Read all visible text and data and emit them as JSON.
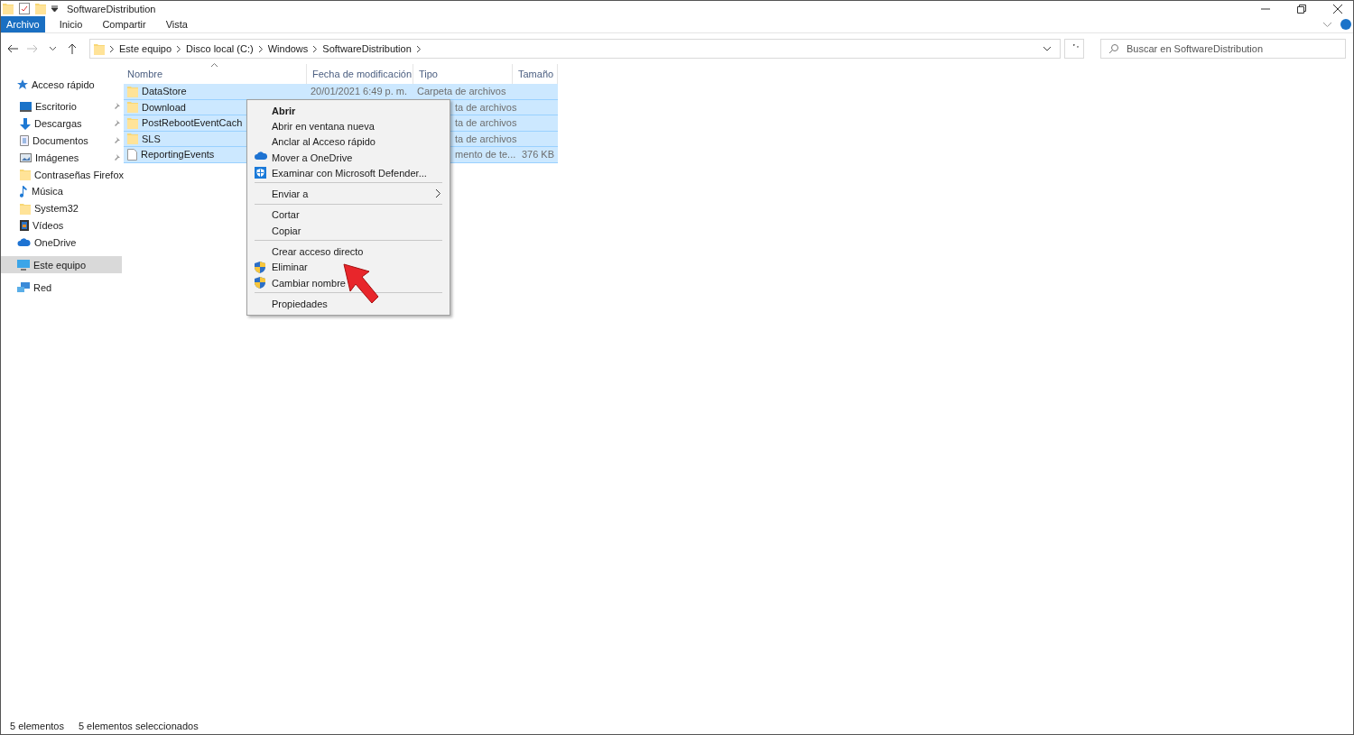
{
  "window": {
    "title": "SoftwareDistribution"
  },
  "ribbon_tabs": [
    {
      "label": "Archivo",
      "selected": true
    },
    {
      "label": "Inicio",
      "selected": false
    },
    {
      "label": "Compartir",
      "selected": false
    },
    {
      "label": "Vista",
      "selected": false
    }
  ],
  "address": {
    "crumbs": [
      "Este equipo",
      "Disco local (C:)",
      "Windows",
      "SoftwareDistribution"
    ]
  },
  "search": {
    "placeholder": "Buscar en SoftwareDistribution"
  },
  "sidebar": {
    "items": [
      {
        "label": "Acceso rápido",
        "selected": false,
        "children": [
          {
            "label": "Escritorio",
            "selected": false,
            "pinned": true
          },
          {
            "label": "Descargas",
            "selected": false,
            "pinned": true
          },
          {
            "label": "Documentos",
            "selected": false,
            "pinned": true
          },
          {
            "label": "Imágenes",
            "selected": false,
            "pinned": true
          },
          {
            "label": "Contraseñas Firefox",
            "selected": false,
            "pinned": false
          },
          {
            "label": "Música",
            "selected": false,
            "pinned": false
          },
          {
            "label": "System32",
            "selected": false,
            "pinned": false
          },
          {
            "label": "Vídeos",
            "selected": false,
            "pinned": false
          }
        ]
      },
      {
        "label": "OneDrive",
        "selected": false
      },
      {
        "label": "Este equipo",
        "selected": true
      },
      {
        "label": "Red",
        "selected": false
      }
    ]
  },
  "table": {
    "columns": [
      "Nombre",
      "Fecha de modificación",
      "Tipo",
      "Tamaño"
    ],
    "rows": [
      {
        "kind": "folder",
        "name": "DataStore",
        "date": "20/01/2021 6:49 p. m.",
        "type": "Carpeta de archivos",
        "size": "",
        "selected": true
      },
      {
        "kind": "folder",
        "name": "Download",
        "date": "",
        "type": "ta de archivos",
        "size": "",
        "selected": true
      },
      {
        "kind": "folder",
        "name": "PostRebootEventCach",
        "date": "",
        "type": "ta de archivos",
        "size": "",
        "selected": true
      },
      {
        "kind": "folder",
        "name": "SLS",
        "date": "",
        "type": "ta de archivos",
        "size": "",
        "selected": true
      },
      {
        "kind": "file",
        "name": "ReportingEvents",
        "date": "",
        "type": "mento de te...",
        "size": "376 KB",
        "selected": true
      }
    ]
  },
  "context_menu": {
    "items": [
      {
        "kind": "plain",
        "label": "Abrir",
        "bold": true
      },
      {
        "kind": "plain",
        "label": "Abrir en ventana nueva",
        "bold": false
      },
      {
        "kind": "plain",
        "label": "Anclar al Acceso rápido",
        "bold": false
      },
      {
        "kind": "cloud",
        "label": "Mover a OneDrive",
        "bold": false
      },
      {
        "kind": "defender",
        "label": "Examinar con Microsoft Defender...",
        "bold": false
      },
      {
        "kind": "separator"
      },
      {
        "kind": "submenu",
        "label": "Enviar a",
        "bold": false
      },
      {
        "kind": "separator"
      },
      {
        "kind": "plain",
        "label": "Cortar",
        "bold": false
      },
      {
        "kind": "plain",
        "label": "Copiar",
        "bold": false
      },
      {
        "kind": "separator"
      },
      {
        "kind": "plain",
        "label": "Crear acceso directo",
        "bold": false
      },
      {
        "kind": "shield",
        "label": "Eliminar",
        "bold": false
      },
      {
        "kind": "shield",
        "label": "Cambiar nombre",
        "bold": false
      },
      {
        "kind": "separator"
      },
      {
        "kind": "plain",
        "label": "Propiedades",
        "bold": false
      }
    ]
  },
  "status_bar": {
    "items": [
      "5 elementos",
      "5 elementos seleccionados"
    ]
  }
}
